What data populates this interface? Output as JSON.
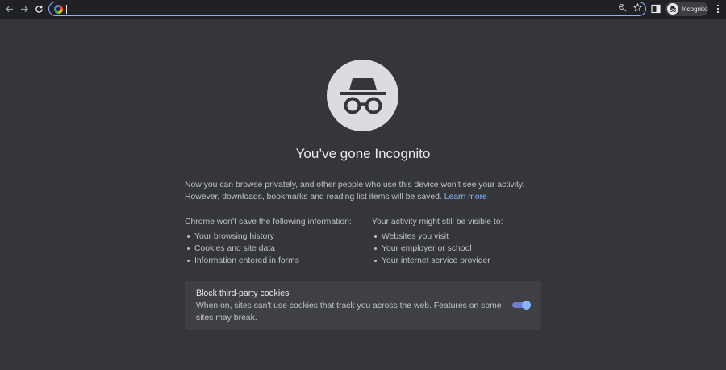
{
  "toolbar": {
    "omnibox_value": "",
    "profile_label": "Incognito"
  },
  "content": {
    "title": "You’ve gone Incognito",
    "intro_line1": "Now you can browse privately, and other people who use this device won’t see your activity.",
    "intro_line2": "However, downloads, bookmarks and reading list items will be saved.",
    "learn_more": "Learn more",
    "left_column": {
      "heading": "Chrome won’t save the following information:",
      "items": [
        "Your browsing history",
        "Cookies and site data",
        "Information entered in forms"
      ]
    },
    "right_column": {
      "heading": "Your activity might still be visible to:",
      "items": [
        "Websites you visit",
        "Your employer or school",
        "Your internet service provider"
      ]
    },
    "cookie_card": {
      "title": "Block third-party cookies",
      "description": "When on, sites can't use cookies that track you across the web. Features on some sites may break.",
      "toggle_on": true
    }
  },
  "icons": {
    "back": "back-arrow-icon",
    "forward": "forward-arrow-icon",
    "reload": "reload-icon",
    "site": "google-icon",
    "zoom": "zoom-icon",
    "bookmark": "star-icon",
    "side_panel": "side-panel-icon",
    "profile": "incognito-icon",
    "menu": "kebab-menu-icon",
    "hero": "incognito-icon"
  },
  "colors": {
    "page_bg": "#35363a",
    "toolbar_bg": "#202124",
    "accent": "#8ab4f8",
    "card_bg": "#3f4044"
  }
}
